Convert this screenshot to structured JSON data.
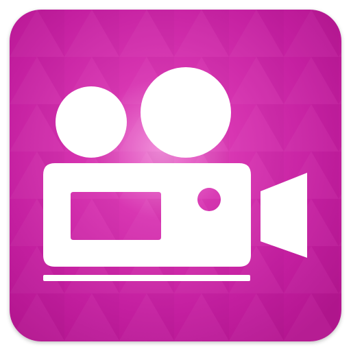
{
  "icon": {
    "name": "video-camera-icon",
    "colors": {
      "base": "#c41fa0",
      "highlight": "#f08bd8",
      "mid": "#d836b2",
      "edge": "#b3158f",
      "foreground": "#ffffff"
    }
  }
}
